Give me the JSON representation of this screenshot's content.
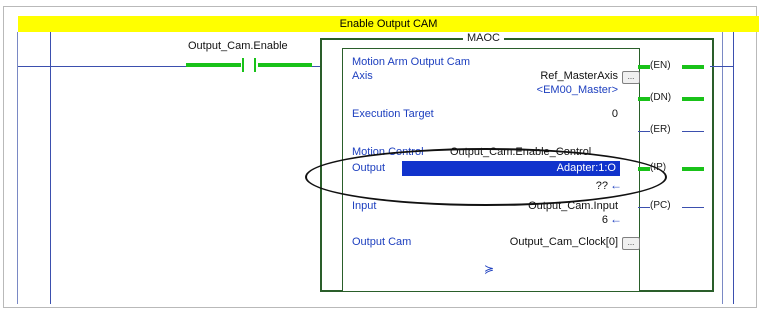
{
  "rung": {
    "title": "Enable Output CAM",
    "contact_tag": "Output_Cam.Enable"
  },
  "instruction": {
    "mnemonic": "MAOC",
    "description": "Motion Arm Output Cam",
    "rows": [
      {
        "label": "Axis",
        "value": "Ref_MasterAxis",
        "browse": true
      },
      {
        "label": "",
        "value": "<EM00_Master>"
      },
      {
        "label": "Execution Target",
        "value": "0"
      },
      {
        "label": "Motion Control",
        "value": "Output_Cam.Enable_Control"
      },
      {
        "label": "Output",
        "value": "Adapter:1:O",
        "selected": true
      },
      {
        "label": "",
        "value": "??",
        "arrow": "←"
      },
      {
        "label": "Input",
        "value": "Output_Cam.Input"
      },
      {
        "label": "",
        "value": "6",
        "arrow": "←"
      },
      {
        "label": "Output Cam",
        "value": "Output_Cam_Clock[0]",
        "browse": true
      }
    ],
    "expand_glyph": "≽",
    "browse_glyph": "...",
    "outputs": [
      "EN",
      "DN",
      "ER",
      "IP",
      "PC"
    ]
  },
  "colors": {
    "rung_title_bg": "#ffff00",
    "energized": "#19c219",
    "wire": "#3b4fae",
    "selection": "#1133cc"
  }
}
